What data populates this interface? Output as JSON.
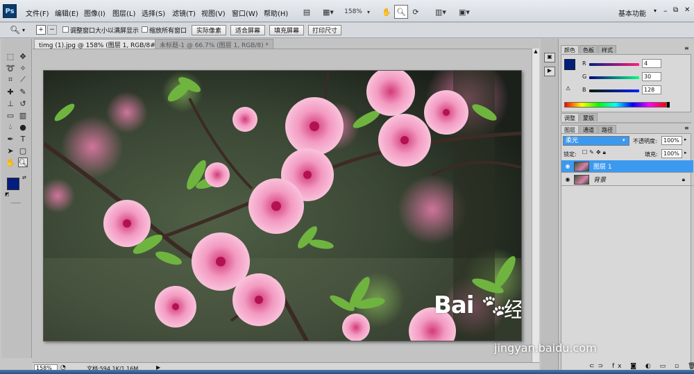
{
  "app": {
    "logo": "Ps"
  },
  "menu": [
    "文件(F)",
    "编辑(E)",
    "图像(I)",
    "图层(L)",
    "选择(S)",
    "滤镜(T)",
    "视图(V)",
    "窗口(W)",
    "帮助(H)"
  ],
  "toolbar": {
    "zoom_percent": "158%",
    "workspace": "基本功能"
  },
  "options": {
    "resize_windows_label": "调整窗口大小以满屏显示",
    "zoom_all_label": "缩放所有窗口",
    "actual_pixels": "实际像素",
    "fit_screen": "适合屏幕",
    "fill_screen": "填充屏幕",
    "print_size": "打印尺寸"
  },
  "tabs": [
    {
      "label": "timg (1).jpg @ 158% (图层 1, RGB/8#) *"
    },
    {
      "label": "未标题-1 @ 66.7% (图层 1, RGB/8) *"
    }
  ],
  "status": {
    "zoom": "158%",
    "doc": "文档:594.1K/1.16M"
  },
  "color_panel": {
    "tabs": [
      "颜色",
      "色板",
      "样式"
    ],
    "r": "4",
    "g": "30",
    "b": "128",
    "r_label": "R",
    "g_label": "G",
    "b_label": "B",
    "foreground": "#041e80"
  },
  "adjust_panel": {
    "tabs": [
      "调整",
      "蒙版"
    ]
  },
  "layers_panel": {
    "tabs": [
      "图层",
      "通道",
      "路径"
    ],
    "blend_mode": "柔光",
    "opacity_label": "不透明度:",
    "opacity": "100%",
    "lock_label": "锁定:",
    "fill_label": "填充:",
    "fill": "100%",
    "layers": [
      {
        "name": "图层 1",
        "selected": true
      },
      {
        "name": "背景",
        "selected": false
      }
    ]
  },
  "watermark": {
    "brand": "Bai",
    "brand2": "经验",
    "url": "jingyan.baidu.com"
  }
}
